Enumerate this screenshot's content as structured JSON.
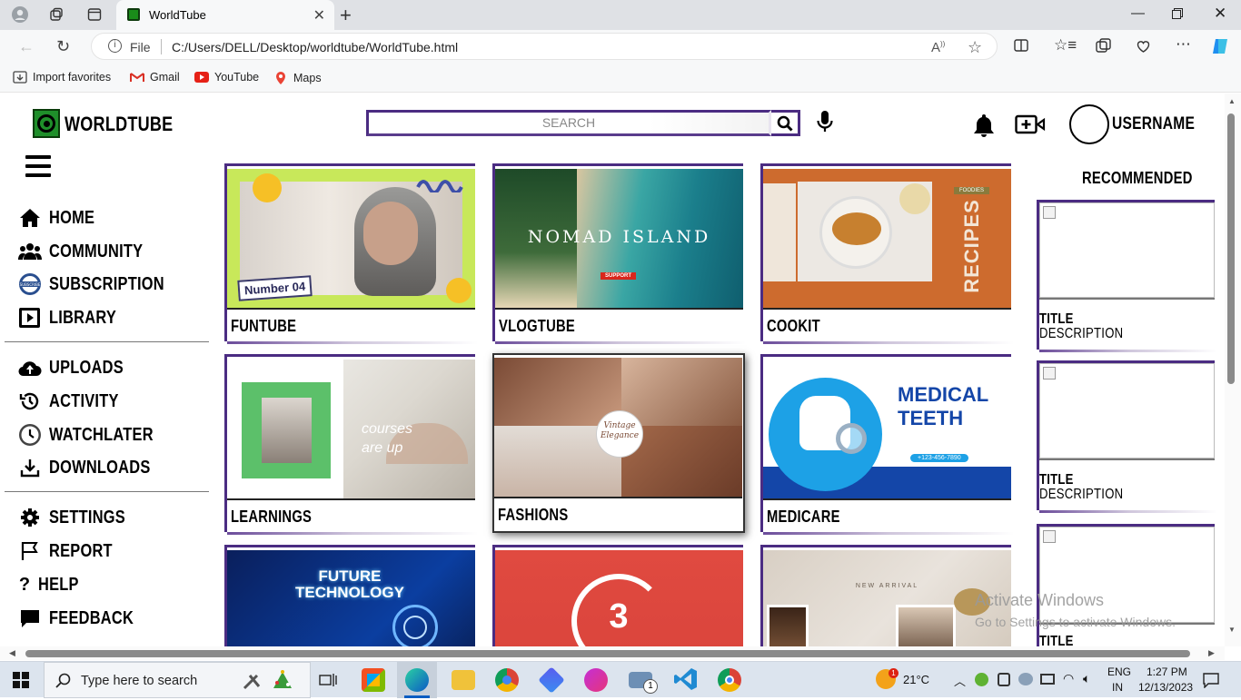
{
  "browser": {
    "tab_title": "WorldTube",
    "address_prefix": "File",
    "url": "C:/Users/DELL/Desktop/worldtube/WorldTube.html",
    "favorites": [
      "Import favorites",
      "Gmail",
      "YouTube",
      "Maps"
    ]
  },
  "header": {
    "logo_text": "WORLDTUBE",
    "search_placeholder": "SEARCH",
    "username": "USERNAME"
  },
  "sidebar": {
    "group1": [
      {
        "label": "HOME",
        "icon": "home-icon"
      },
      {
        "label": "COMMUNITY",
        "icon": "community-icon"
      },
      {
        "label": "SUBSCRIPTION",
        "icon": "subscription-icon"
      },
      {
        "label": "LIBRARY",
        "icon": "library-icon"
      }
    ],
    "group2": [
      {
        "label": "UPLOADS",
        "icon": "upload-icon"
      },
      {
        "label": "ACTIVITY",
        "icon": "history-icon"
      },
      {
        "label": "WATCHLATER",
        "icon": "clock-icon"
      },
      {
        "label": "DOWNLOADS",
        "icon": "download-icon"
      }
    ],
    "group3": [
      {
        "label": "SETTINGS",
        "icon": "gear-icon"
      },
      {
        "label": "REPORT",
        "icon": "flag-icon"
      },
      {
        "label": "HELP",
        "icon": "question-icon"
      },
      {
        "label": "FEEDBACK",
        "icon": "feedback-icon"
      }
    ]
  },
  "videos": [
    {
      "title": "FUNTUBE",
      "thumb_text": "Number 04"
    },
    {
      "title": "VLOGTUBE",
      "thumb_text": "NOMAD ISLAND",
      "thumb_sub": "SUPPORT"
    },
    {
      "title": "COOKIT",
      "thumb_text": "RECIPES",
      "thumb_sub": "FOODIES"
    },
    {
      "title": "LEARNINGS",
      "thumb_text": "courses are up"
    },
    {
      "title": "FASHIONS",
      "thumb_text": "Vintage Elegance"
    },
    {
      "title": "MEDICARE",
      "thumb_text": "MEDICAL TEETH",
      "thumb_sub": "+123-456-7890"
    },
    {
      "title": "",
      "thumb_text": "FUTURE TECHNOLOGY"
    },
    {
      "title": "",
      "thumb_text": "3"
    },
    {
      "title": "",
      "thumb_text": "NEW ARRIVAL"
    }
  ],
  "recommended": {
    "heading": "RECOMMENDED",
    "items": [
      {
        "title": "TITLE",
        "description": "DESCRIPTION"
      },
      {
        "title": "TITLE",
        "description": "DESCRIPTION"
      },
      {
        "title": "TITLE",
        "description": ""
      }
    ]
  },
  "watermark": {
    "line1": "Activate Windows",
    "line2": "Go to Settings to activate Windows."
  },
  "taskbar": {
    "search_placeholder": "Type here to search",
    "weather": "21°C",
    "lang1": "ENG",
    "lang2": "IN",
    "time": "1:27 PM",
    "date": "12/13/2023",
    "weather_badge": "1",
    "mail_badge": "1"
  },
  "colors": {
    "accent": "#4b2c82",
    "logo_green": "#1f8f2a"
  }
}
